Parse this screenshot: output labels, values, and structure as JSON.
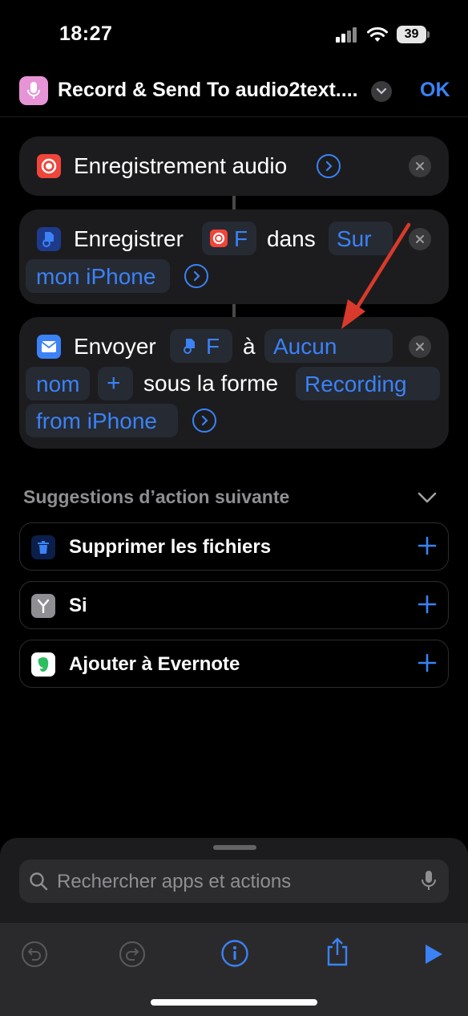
{
  "status_bar": {
    "time": "18:27",
    "battery": "39"
  },
  "header": {
    "title": "Record & Send To audio2text....",
    "ok_label": "OK"
  },
  "actions": {
    "record": {
      "label": "Enregistrement audio"
    },
    "save": {
      "verb": "Enregistrer",
      "variable": "F",
      "preposition": "dans",
      "destination_line1": "Sur",
      "destination_line2": "mon iPhone"
    },
    "send": {
      "verb": "Envoyer",
      "variable": "F",
      "preposition": "à",
      "recipient_line1": "Aucun",
      "recipient_line2": "nom",
      "add_symbol": "+",
      "as_text": "sous la forme",
      "subject_line1": "Recording",
      "subject_line2": "from iPhone"
    }
  },
  "suggestions": {
    "title": "Suggestions d’action suivante",
    "items": [
      {
        "label": "Supprimer les fichiers",
        "icon": "trash-icon",
        "color": "#1e3a8a"
      },
      {
        "label": "Si",
        "icon": "branch-icon",
        "color": "#8e8e93"
      },
      {
        "label": "Ajouter à Evernote",
        "icon": "evernote-icon",
        "color": "#ffffff"
      }
    ]
  },
  "search": {
    "placeholder": "Rechercher apps et actions"
  },
  "colors": {
    "accent": "#3b82f6",
    "record_red": "#f0453a",
    "arrow_red": "#d93a2b"
  }
}
